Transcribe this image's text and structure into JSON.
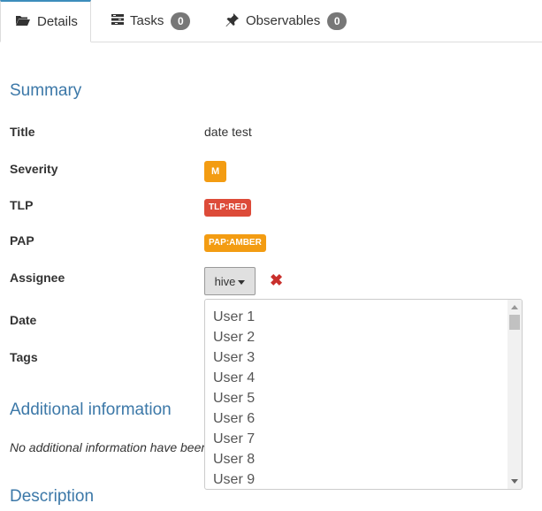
{
  "tabs": [
    {
      "label": "Details",
      "icon": "folder-open-icon"
    },
    {
      "label": "Tasks",
      "icon": "tasks-icon",
      "count": "0"
    },
    {
      "label": "Observables",
      "icon": "pushpin-icon",
      "count": "0"
    }
  ],
  "summary": {
    "heading": "Summary",
    "title_label": "Title",
    "title_value": "date test",
    "severity_label": "Severity",
    "severity_value": "M",
    "tlp_label": "TLP",
    "tlp_value": "TLP:RED",
    "pap_label": "PAP",
    "pap_value": "PAP:AMBER",
    "assignee_label": "Assignee",
    "assignee_value": "hive",
    "date_label": "Date",
    "tags_label": "Tags"
  },
  "assignee_options": [
    "User 1",
    "User 2",
    "User 3",
    "User 4",
    "User 5",
    "User 6",
    "User 7",
    "User 8",
    "User 9"
  ],
  "additional": {
    "heading": "Additional information",
    "empty_text": "No additional information have been specified"
  },
  "description": {
    "heading": "Description"
  },
  "colors": {
    "accent": "#3c78a8",
    "severity": "#f39c12",
    "tlp_red": "#dd4b39",
    "pap_amber": "#f39c12",
    "remove": "#c9302c"
  }
}
